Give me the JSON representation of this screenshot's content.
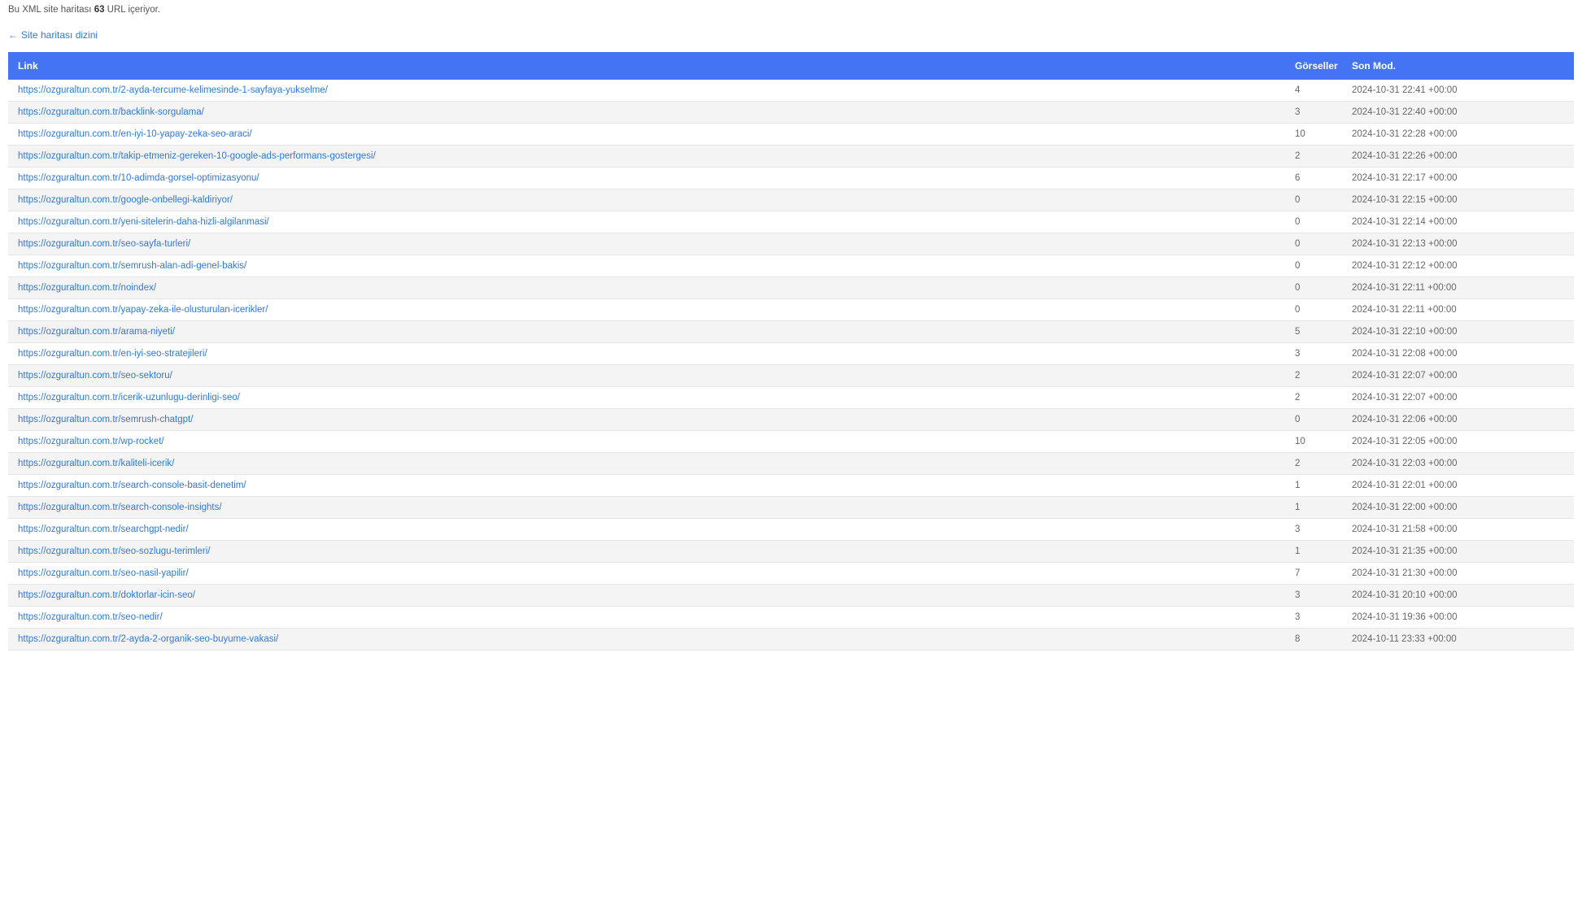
{
  "summary": {
    "prefix": "Bu XML site haritası ",
    "count": "63",
    "suffix": " URL içeriyor."
  },
  "backlink": {
    "arrow": "←",
    "label": "Site haritası dizini"
  },
  "table": {
    "headers": {
      "link": "Link",
      "images": "Görseller",
      "lastmod": "Son Mod."
    },
    "rows": [
      {
        "url": "https://ozguraltun.com.tr/2-ayda-tercume-kelimesinde-1-sayfaya-yukselme/",
        "images": "4",
        "lastmod": "2024-10-31 22:41 +00:00"
      },
      {
        "url": "https://ozguraltun.com.tr/backlink-sorgulama/",
        "images": "3",
        "lastmod": "2024-10-31 22:40 +00:00"
      },
      {
        "url": "https://ozguraltun.com.tr/en-iyi-10-yapay-zeka-seo-araci/",
        "images": "10",
        "lastmod": "2024-10-31 22:28 +00:00"
      },
      {
        "url": "https://ozguraltun.com.tr/takip-etmeniz-gereken-10-google-ads-performans-gostergesi/",
        "images": "2",
        "lastmod": "2024-10-31 22:26 +00:00"
      },
      {
        "url": "https://ozguraltun.com.tr/10-adimda-gorsel-optimizasyonu/",
        "images": "6",
        "lastmod": "2024-10-31 22:17 +00:00"
      },
      {
        "url": "https://ozguraltun.com.tr/google-onbellegi-kaldiriyor/",
        "images": "0",
        "lastmod": "2024-10-31 22:15 +00:00"
      },
      {
        "url": "https://ozguraltun.com.tr/yeni-sitelerin-daha-hizli-algilanmasi/",
        "images": "0",
        "lastmod": "2024-10-31 22:14 +00:00"
      },
      {
        "url": "https://ozguraltun.com.tr/seo-sayfa-turleri/",
        "images": "0",
        "lastmod": "2024-10-31 22:13 +00:00"
      },
      {
        "url": "https://ozguraltun.com.tr/semrush-alan-adi-genel-bakis/",
        "images": "0",
        "lastmod": "2024-10-31 22:12 +00:00"
      },
      {
        "url": "https://ozguraltun.com.tr/noindex/",
        "images": "0",
        "lastmod": "2024-10-31 22:11 +00:00"
      },
      {
        "url": "https://ozguraltun.com.tr/yapay-zeka-ile-olusturulan-icerikler/",
        "images": "0",
        "lastmod": "2024-10-31 22:11 +00:00"
      },
      {
        "url": "https://ozguraltun.com.tr/arama-niyeti/",
        "images": "5",
        "lastmod": "2024-10-31 22:10 +00:00"
      },
      {
        "url": "https://ozguraltun.com.tr/en-iyi-seo-stratejileri/",
        "images": "3",
        "lastmod": "2024-10-31 22:08 +00:00"
      },
      {
        "url": "https://ozguraltun.com.tr/seo-sektoru/",
        "images": "2",
        "lastmod": "2024-10-31 22:07 +00:00"
      },
      {
        "url": "https://ozguraltun.com.tr/icerik-uzunlugu-derinligi-seo/",
        "images": "2",
        "lastmod": "2024-10-31 22:07 +00:00"
      },
      {
        "url": "https://ozguraltun.com.tr/semrush-chatgpt/",
        "images": "0",
        "lastmod": "2024-10-31 22:06 +00:00"
      },
      {
        "url": "https://ozguraltun.com.tr/wp-rocket/",
        "images": "10",
        "lastmod": "2024-10-31 22:05 +00:00"
      },
      {
        "url": "https://ozguraltun.com.tr/kaliteli-icerik/",
        "images": "2",
        "lastmod": "2024-10-31 22:03 +00:00"
      },
      {
        "url": "https://ozguraltun.com.tr/search-console-basit-denetim/",
        "images": "1",
        "lastmod": "2024-10-31 22:01 +00:00"
      },
      {
        "url": "https://ozguraltun.com.tr/search-console-insights/",
        "images": "1",
        "lastmod": "2024-10-31 22:00 +00:00"
      },
      {
        "url": "https://ozguraltun.com.tr/searchgpt-nedir/",
        "images": "3",
        "lastmod": "2024-10-31 21:58 +00:00"
      },
      {
        "url": "https://ozguraltun.com.tr/seo-sozlugu-terimleri/",
        "images": "1",
        "lastmod": "2024-10-31 21:35 +00:00"
      },
      {
        "url": "https://ozguraltun.com.tr/seo-nasil-yapilir/",
        "images": "7",
        "lastmod": "2024-10-31 21:30 +00:00"
      },
      {
        "url": "https://ozguraltun.com.tr/doktorlar-icin-seo/",
        "images": "3",
        "lastmod": "2024-10-31 20:10 +00:00"
      },
      {
        "url": "https://ozguraltun.com.tr/seo-nedir/",
        "images": "3",
        "lastmod": "2024-10-31 19:36 +00:00"
      },
      {
        "url": "https://ozguraltun.com.tr/2-ayda-2-organik-seo-buyume-vakasi/",
        "images": "8",
        "lastmod": "2024-10-11 23:33 +00:00"
      }
    ]
  }
}
